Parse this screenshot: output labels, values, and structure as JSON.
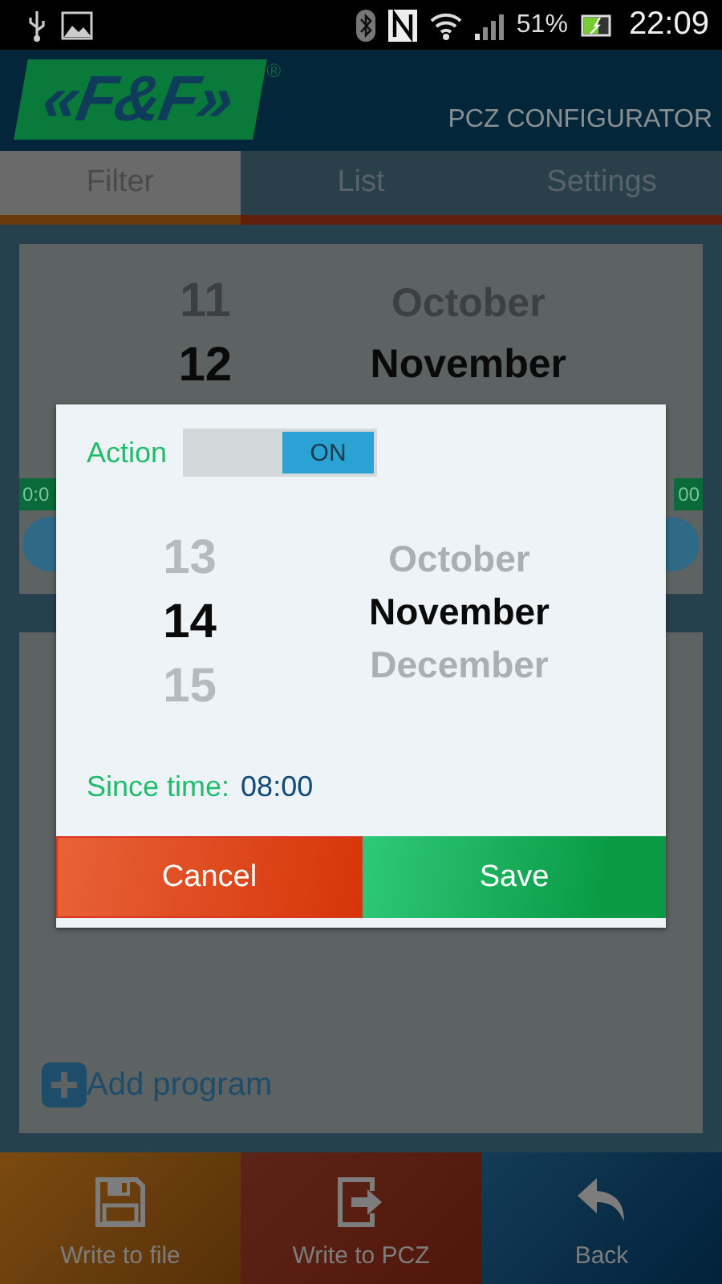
{
  "status_bar": {
    "battery": "51%",
    "time": "22:09"
  },
  "header": {
    "logo": "«F&F»",
    "registered": "®",
    "title": "PCZ CONFIGURATOR"
  },
  "tabs": [
    {
      "label": "Filter",
      "selected": true
    },
    {
      "label": "List",
      "selected": false
    },
    {
      "label": "Settings",
      "selected": false
    }
  ],
  "background_card": {
    "days": [
      {
        "text": "11",
        "selected": false
      },
      {
        "text": "12",
        "selected": true
      }
    ],
    "months": [
      {
        "text": "October",
        "selected": false
      },
      {
        "text": "November",
        "selected": true
      }
    ],
    "start_time": "0:0",
    "end_time": "00"
  },
  "add_program": "Add program",
  "dialog": {
    "action_label": "Action",
    "toggle": {
      "label": "ON",
      "on": true
    },
    "days": [
      {
        "text": "13",
        "selected": false
      },
      {
        "text": "14",
        "selected": true
      },
      {
        "text": "15",
        "selected": false
      }
    ],
    "months": [
      {
        "text": "October",
        "selected": false
      },
      {
        "text": "November",
        "selected": true
      },
      {
        "text": "December",
        "selected": false
      }
    ],
    "since_label": "Since time:",
    "since_value": "08:00",
    "buttons": [
      {
        "label": "Cancel",
        "kind": "cancel"
      },
      {
        "label": "Save",
        "kind": "save"
      }
    ]
  },
  "toolbar": [
    {
      "label": "Write to file",
      "kind": "file"
    },
    {
      "label": "Write to PCZ",
      "kind": "device"
    },
    {
      "label": "Back",
      "kind": "back"
    }
  ]
}
